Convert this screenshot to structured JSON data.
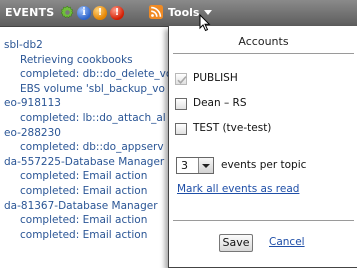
{
  "header": {
    "title": "EVENTS",
    "tools_label": "Tools",
    "icons": [
      "gear-icon",
      "info-icon",
      "warning-icon",
      "error-icon",
      "rss-icon"
    ],
    "info_glyph": "i",
    "warning_glyph": "!",
    "error_glyph": "!"
  },
  "feed": [
    {
      "text": "sbl-db2",
      "indent": false
    },
    {
      "text": "Retrieving cookbooks",
      "indent": true
    },
    {
      "text": "completed: db::do_delete_vo",
      "indent": true
    },
    {
      "text": "EBS volume 'sbl_backup_vo",
      "indent": true
    },
    {
      "text": "eo-918113",
      "indent": false
    },
    {
      "text": "completed: lb::do_attach_al",
      "indent": true
    },
    {
      "text": "eo-288230",
      "indent": false
    },
    {
      "text": "completed: db::do_appserv",
      "indent": true
    },
    {
      "text": "da-557225-Database Manager",
      "indent": false
    },
    {
      "text": "completed: Email action",
      "indent": true
    },
    {
      "text": "completed: Email action",
      "indent": true
    },
    {
      "text": "da-81367-Database Manager",
      "indent": false
    },
    {
      "text": "completed: Email action",
      "indent": true
    },
    {
      "text": "completed: Email action",
      "indent": true
    }
  ],
  "popup": {
    "title": "Accounts",
    "accounts": [
      {
        "label": "PUBLISH",
        "checked": true,
        "disabled": true
      },
      {
        "label": "Dean – RS",
        "checked": false,
        "disabled": false
      },
      {
        "label": "TEST (tve-test)",
        "checked": false,
        "disabled": false
      }
    ],
    "events_per_topic_value": "3",
    "events_per_topic_label": "events per topic",
    "mark_all_label": "Mark all events as read",
    "save_label": "Save",
    "cancel_label": "Cancel"
  },
  "colors": {
    "header_bg": "#6e6e6e",
    "link": "#2a5595",
    "accent_info": "#2d63c8",
    "accent_warning": "#e38300",
    "accent_error": "#d21c00",
    "accent_rss": "#f08a24"
  }
}
